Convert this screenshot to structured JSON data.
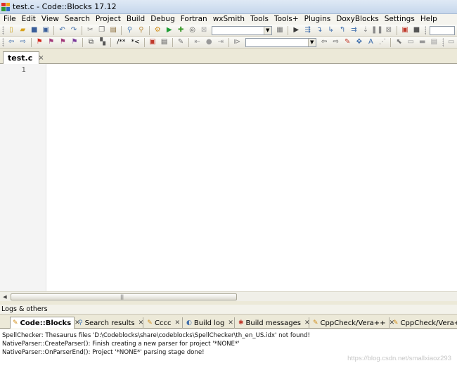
{
  "window": {
    "title": "test.c - Code::Blocks 17.12"
  },
  "menu": [
    "File",
    "Edit",
    "View",
    "Search",
    "Project",
    "Build",
    "Debug",
    "Fortran",
    "wxSmith",
    "Tools",
    "Tools+",
    "Plugins",
    "DoxyBlocks",
    "Settings",
    "Help"
  ],
  "toolbar2": {
    "comment_label": "/**",
    "comment_label2": "*<"
  },
  "editor": {
    "tab_label": "test.c",
    "close_glyph": "×",
    "line_numbers": [
      "1"
    ]
  },
  "scrollbar": {
    "left_arrow": "◀",
    "grip": "|||"
  },
  "logs": {
    "panel_title": "Logs & others",
    "tabs": [
      {
        "label": "Code::Blocks",
        "active": true
      },
      {
        "label": "Search results"
      },
      {
        "label": "Cccc"
      },
      {
        "label": "Build log"
      },
      {
        "label": "Build messages"
      },
      {
        "label": "CppCheck/Vera++"
      },
      {
        "label": "CppCheck/Vera++ m"
      }
    ],
    "lines": [
      "SpellChecker: Thesaurus files 'D:\\Codeblocks\\share\\codeblocks\\SpellChecker\\th_en_US.idx' not found!",
      "NativeParser::CreateParser(): Finish creating a new parser for project '*NONE*'",
      "NativeParser::OnParserEnd(): Project '*NONE*' parsing stage done!"
    ]
  },
  "watermark": "https://blog.csdn.net/smallxiaoz293"
}
